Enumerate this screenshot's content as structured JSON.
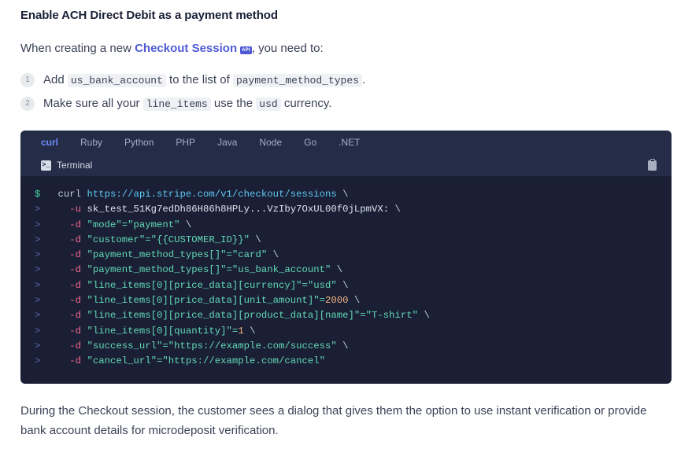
{
  "heading": "Enable ACH Direct Debit as a payment method",
  "intro": {
    "before": "When creating a new ",
    "link_text": "Checkout Session",
    "link_badge": "API",
    "after": ", you need to:"
  },
  "steps": [
    {
      "number": "1",
      "parts": [
        "Add ",
        "us_bank_account",
        " to the list of ",
        "payment_method_types",
        "."
      ]
    },
    {
      "number": "2",
      "parts": [
        "Make sure all your ",
        "line_items",
        " use the ",
        "usd",
        " currency."
      ]
    }
  ],
  "code_block": {
    "tabs": [
      {
        "label": "curl",
        "active": true
      },
      {
        "label": "Ruby",
        "active": false
      },
      {
        "label": "Python",
        "active": false
      },
      {
        "label": "PHP",
        "active": false
      },
      {
        "label": "Java",
        "active": false
      },
      {
        "label": "Node",
        "active": false
      },
      {
        "label": "Go",
        "active": false
      },
      {
        "label": ".NET",
        "active": false
      }
    ],
    "filename": "Terminal",
    "terminal_icon_glyph": ">_",
    "copy_icon": "clipboard-icon",
    "lines": [
      {
        "prompt": "$",
        "tokens": [
          {
            "t": "cmd",
            "v": "curl "
          },
          {
            "t": "url",
            "v": "https://api.stripe.com/v1/checkout/sessions"
          },
          {
            "t": "bslash",
            "v": " \\"
          }
        ]
      },
      {
        "prompt": ">",
        "tokens": [
          {
            "t": "flag",
            "v": "  -u "
          },
          {
            "t": "secret",
            "v": "sk_test_51Kg7edDh86H86h8HPLy...VzIby7OxUL00f0jLpmVX:"
          },
          {
            "t": "bslash",
            "v": " \\"
          }
        ]
      },
      {
        "prompt": ">",
        "tokens": [
          {
            "t": "flag",
            "v": "  -d "
          },
          {
            "t": "str",
            "v": "\"mode\"=\"payment\""
          },
          {
            "t": "bslash",
            "v": " \\"
          }
        ]
      },
      {
        "prompt": ">",
        "tokens": [
          {
            "t": "flag",
            "v": "  -d "
          },
          {
            "t": "str",
            "v": "\"customer\"=\"{{CUSTOMER_ID}}\""
          },
          {
            "t": "bslash",
            "v": " \\"
          }
        ]
      },
      {
        "prompt": ">",
        "tokens": [
          {
            "t": "flag",
            "v": "  -d "
          },
          {
            "t": "str",
            "v": "\"payment_method_types[]\"=\"card\""
          },
          {
            "t": "bslash",
            "v": " \\"
          }
        ]
      },
      {
        "prompt": ">",
        "tokens": [
          {
            "t": "flag",
            "v": "  -d "
          },
          {
            "t": "str",
            "v": "\"payment_method_types[]\"=\"us_bank_account\""
          },
          {
            "t": "bslash",
            "v": " \\"
          }
        ]
      },
      {
        "prompt": ">",
        "tokens": [
          {
            "t": "flag",
            "v": "  -d "
          },
          {
            "t": "str",
            "v": "\"line_items[0][price_data][currency]\"=\"usd\""
          },
          {
            "t": "bslash",
            "v": " \\"
          }
        ]
      },
      {
        "prompt": ">",
        "tokens": [
          {
            "t": "flag",
            "v": "  -d "
          },
          {
            "t": "str",
            "v": "\"line_items[0][price_data][unit_amount]\"="
          },
          {
            "t": "num",
            "v": "2000"
          },
          {
            "t": "bslash",
            "v": " \\"
          }
        ]
      },
      {
        "prompt": ">",
        "tokens": [
          {
            "t": "flag",
            "v": "  -d "
          },
          {
            "t": "str",
            "v": "\"line_items[0][price_data][product_data][name]\"=\"T-shirt\""
          },
          {
            "t": "bslash",
            "v": " \\"
          }
        ]
      },
      {
        "prompt": ">",
        "tokens": [
          {
            "t": "flag",
            "v": "  -d "
          },
          {
            "t": "str",
            "v": "\"line_items[0][quantity]\"="
          },
          {
            "t": "num",
            "v": "1"
          },
          {
            "t": "bslash",
            "v": " \\"
          }
        ]
      },
      {
        "prompt": ">",
        "tokens": [
          {
            "t": "flag",
            "v": "  -d "
          },
          {
            "t": "str",
            "v": "\"success_url\"=\"https://example.com/success\""
          },
          {
            "t": "bslash",
            "v": " \\"
          }
        ]
      },
      {
        "prompt": ">",
        "tokens": [
          {
            "t": "flag",
            "v": "  -d "
          },
          {
            "t": "str",
            "v": "\"cancel_url\"=\"https://example.com/cancel\""
          }
        ]
      }
    ]
  },
  "outro": "During the Checkout session, the customer sees a dialog that gives them the option to use instant verification or provide bank account details for microdeposit verification.",
  "colors": {
    "heading": "#1a1f36",
    "body_text": "#3c4257",
    "link": "#4f5bd5",
    "code_bg": "#1a1f36",
    "code_header_bg": "#252c48",
    "tab_active": "#6d8cf7",
    "chip_bg": "#f0f1f4"
  }
}
